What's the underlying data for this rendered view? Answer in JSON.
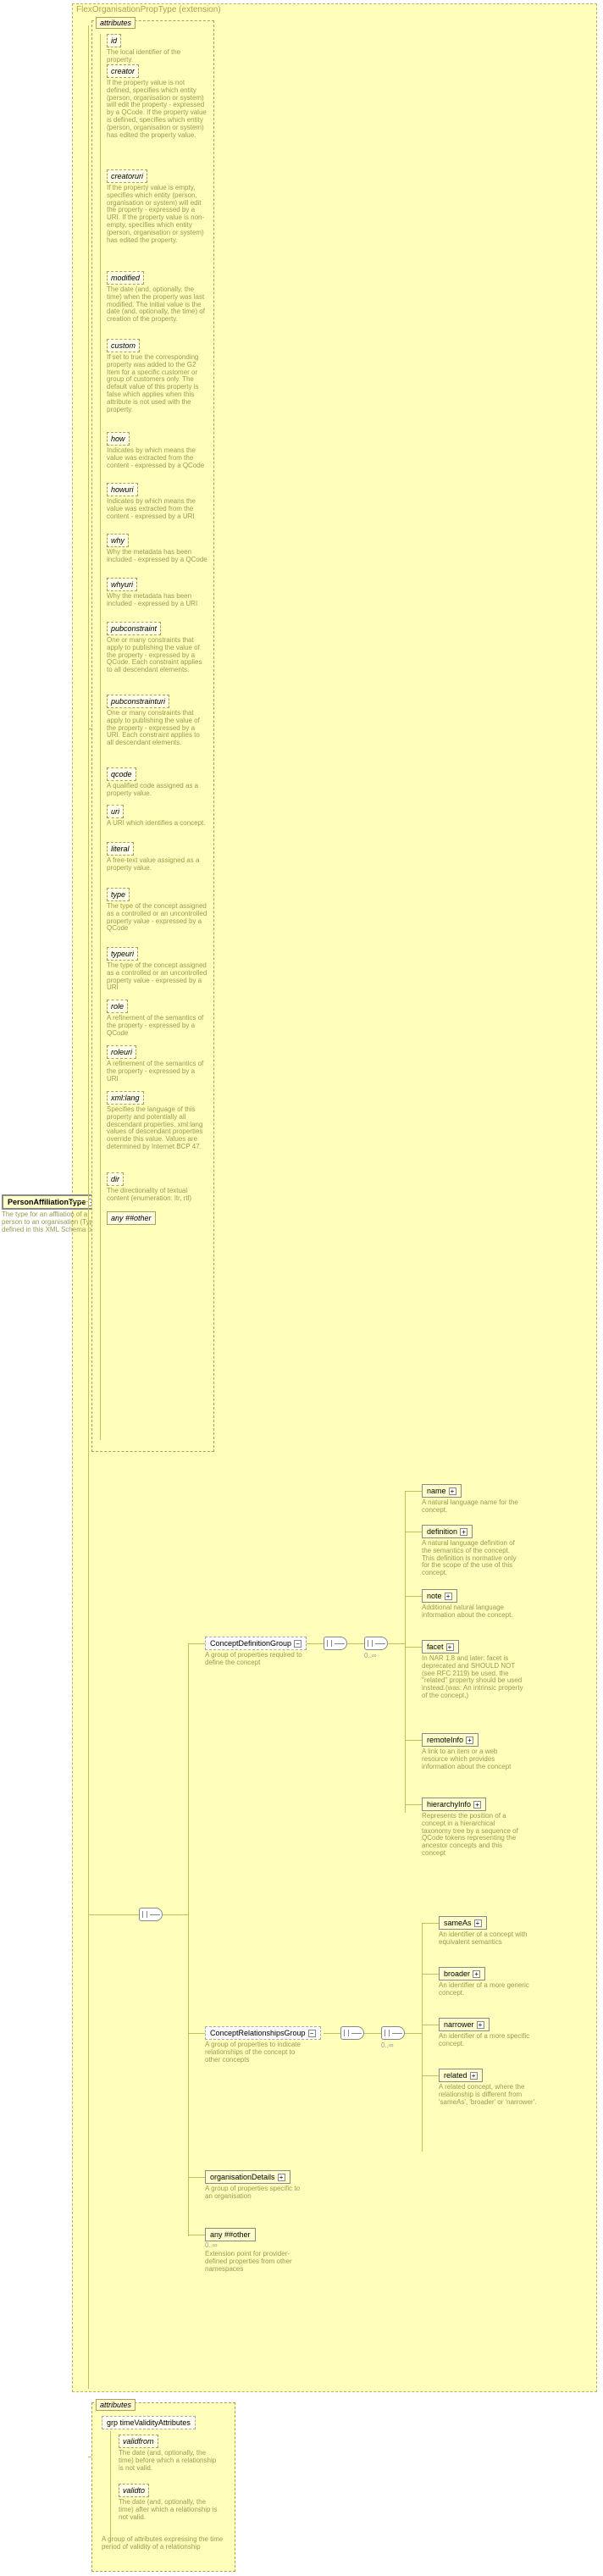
{
  "extension_title": "FlexOrganisationPropType (extension)",
  "root": {
    "name": "PersonAffiliationType",
    "desc": "The type for an affliation of a person to an organisation (Type defined in this XML Schema only)"
  },
  "attributes_label": "attributes",
  "attrs": {
    "id": {
      "name": "id",
      "desc": "The local identifier of the property."
    },
    "creator": {
      "name": "creator",
      "desc": "If the property value is not defined, specifies which entity (person, organisation or system) will edit the property - expressed by a QCode. If the property value is defined, specifies which entity (person, organisation or system) has edited the property value."
    },
    "creatoruri": {
      "name": "creatoruri",
      "desc": "If the property value is empty, specifies which entity (person, organisation or system) will edit the property - expressed by a URI. If the property value is non-empty, specifies which entity (person, organisation or system) has edited the property."
    },
    "modified": {
      "name": "modified",
      "desc": "The date (and, optionally, the time) when the property was last modified. The initial value is the date (and, optionally, the time) of creation of the property."
    },
    "custom": {
      "name": "custom",
      "desc": "If set to true the corresponding property was added to the G2 Item for a specific customer or group of customers only. The default value of this property is false which applies when this attribute is not used with the property."
    },
    "how": {
      "name": "how",
      "desc": "Indicates by which means the value was extracted from the content - expressed by a QCode"
    },
    "howuri": {
      "name": "howuri",
      "desc": "Indicates by which means the value was extracted from the content - expressed by a URI"
    },
    "why": {
      "name": "why",
      "desc": "Why the metadata has been included - expressed by a QCode"
    },
    "whyuri": {
      "name": "whyuri",
      "desc": "Why the metadata has been included - expressed by a URI"
    },
    "pubconstraint": {
      "name": "pubconstraint",
      "desc": "One or many constraints that apply to publishing the value of the property - expressed by a QCode. Each constraint applies to all descendant elements."
    },
    "pubconstrainturi": {
      "name": "pubconstrainturi",
      "desc": "One or many constraints that apply to publishing the value of the property - expressed by a URI. Each constraint applies to all descendant elements."
    },
    "qcode": {
      "name": "qcode",
      "desc": "A qualified code assigned as a property value."
    },
    "uri": {
      "name": "uri",
      "desc": "A URI which identifies a concept."
    },
    "literal": {
      "name": "literal",
      "desc": "A free-text value assigned as a property value."
    },
    "type": {
      "name": "type",
      "desc": "The type of the concept assigned as a controlled or an uncontrolled property value - expressed by a QCode"
    },
    "typeuri": {
      "name": "typeuri",
      "desc": "The type of the concept assigned as a controlled or an uncontrolled property value - expressed by a URI"
    },
    "role": {
      "name": "role",
      "desc": "A refinement of the semantics of the property - expressed by a QCode"
    },
    "roleuri": {
      "name": "roleuri",
      "desc": "A refinement of the semantics of the property - expressed by a URI"
    },
    "xmllang": {
      "name": "xml:lang",
      "desc": "Specifies the language of this property and potentially all descendant properties. xml:lang values of descendant properties override this value. Values are determined by Internet BCP 47."
    },
    "dir": {
      "name": "dir",
      "desc": "The directionality of textual content (enumeration: ltr, rtl)"
    },
    "anyother": {
      "name": "any ##other"
    }
  },
  "groups": {
    "cdg": {
      "name": "ConceptDefinitionGroup",
      "desc": "A group of properties required to define the concept"
    },
    "crg": {
      "name": "ConceptRelationshipsGroup",
      "desc": "A group of properties to indicate relationships of the concept to other concepts"
    }
  },
  "elems": {
    "name_": {
      "name": "name",
      "desc": "A natural language name for the concept."
    },
    "definition": {
      "name": "definition",
      "desc": "A natural language definition of the semantics of the concept. This definition is normative only for the scope of the use of this concept."
    },
    "note": {
      "name": "note",
      "desc": "Additional natural language information about the concept."
    },
    "facet": {
      "name": "facet",
      "desc": "In NAR 1.8 and later: facet is deprecated and SHOULD NOT (see RFC 2119) be used, the \"related\" property should be used instead.(was: An intrinsic property of the concept.)"
    },
    "remoteInfo": {
      "name": "remoteInfo",
      "desc": "A link to an item or a web resource which provides information about the concept"
    },
    "hierarchyInfo": {
      "name": "hierarchyInfo",
      "desc": "Represents the position of a concept in a hierarchical taxonomy tree by a sequence of QCode tokens representing the ancestor concepts and this concept"
    },
    "sameAs": {
      "name": "sameAs",
      "desc": "An identifier of a concept with equivalent semantics"
    },
    "broader": {
      "name": "broader",
      "desc": "An identifier of a more generic concept."
    },
    "narrower": {
      "name": "narrower",
      "desc": "An identifier of a more specific concept."
    },
    "related": {
      "name": "related",
      "desc": "A related concept, where the relationship is different from 'sameAs', 'broader' or 'narrower'."
    },
    "orgDetails": {
      "name": "organisationDetails",
      "desc": "A group of properties specific to an organisation"
    },
    "any2": {
      "name": "any ##other",
      "desc": "Extension point for provider-defined properties from other namespaces"
    }
  },
  "time_attrs": {
    "group_name": "grp timeValidityAttributes",
    "validfrom": {
      "name": "validfrom",
      "desc": "The date (and, optionally, the time) before which a relationship is not valid."
    },
    "validto": {
      "name": "validto",
      "desc": "The date (and, optionally, the time) after which a relationship is not valid."
    },
    "group_desc": "A group of attributes expressing the time period of validity of a relationship"
  },
  "occ": {
    "zero_inf": "0..∞"
  }
}
